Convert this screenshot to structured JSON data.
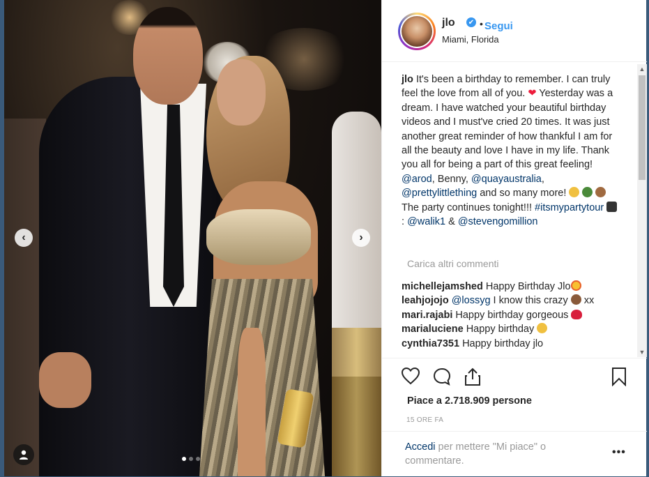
{
  "header": {
    "username": "jlo",
    "verified_icon": "✔",
    "separator": "•",
    "follow_label": "Segui",
    "location": "Miami, Florida"
  },
  "caption": {
    "author": "jlo",
    "text_1": " It's been a birthday to remember. I can truly feel the love from all of you. ",
    "text_2": " Yesterday was a dream. I have watched your beautiful birthday videos and I must've cried 20 times. It was just another great reminder of how thankful I am for all the beauty and love I have in my life. Thank you all for being a part of this great feeling! ",
    "mention_arod": "@arod",
    "text_3": ", Benny, ",
    "mention_quay": "@quayaustralia",
    "text_4": ", ",
    "mention_plt": "@prettylittlething",
    "text_5": " and so many more! ",
    "text_6": " The party continues tonight!!! ",
    "hashtag": "#itsmypartytour",
    "text_7": ": ",
    "mention_walik": "@walik1",
    "text_8": " & ",
    "mention_steven": "@stevengomillion"
  },
  "load_more_label": "Carica altri commenti",
  "comments": [
    {
      "user": "michellejamshed",
      "text": "Happy Birthday Jlo",
      "emoji": "heart-eyes-emoji"
    },
    {
      "user": "leahjojojo",
      "mention": "@lossyg",
      "text": " I know this crazy ",
      "emoji": "see-no-evil-monkey-emoji",
      "suffix": " xx"
    },
    {
      "user": "mari.rajabi",
      "text": "Happy birthday gorgeous ",
      "emoji": "red-heart-emoji"
    },
    {
      "user": "marialuciene",
      "text": "Happy birthday ",
      "emoji": "party-face-emoji"
    },
    {
      "user": "cynthia7351",
      "text": "Happy birthday jlo"
    }
  ],
  "likes": "Piace a 2.718.909 persone",
  "time": "15 ORE FA",
  "add_comment": {
    "link": "Accedi",
    "text": " per mettere \"Mi piace\" o commentare."
  },
  "more_label": "•••",
  "nav": {
    "prev": "‹",
    "next": "›"
  },
  "carousel": {
    "count": 3,
    "active": 1
  },
  "colors": {
    "link": "#003569",
    "follow": "#3897f0",
    "verified": "#3897f0",
    "muted": "#999999"
  }
}
